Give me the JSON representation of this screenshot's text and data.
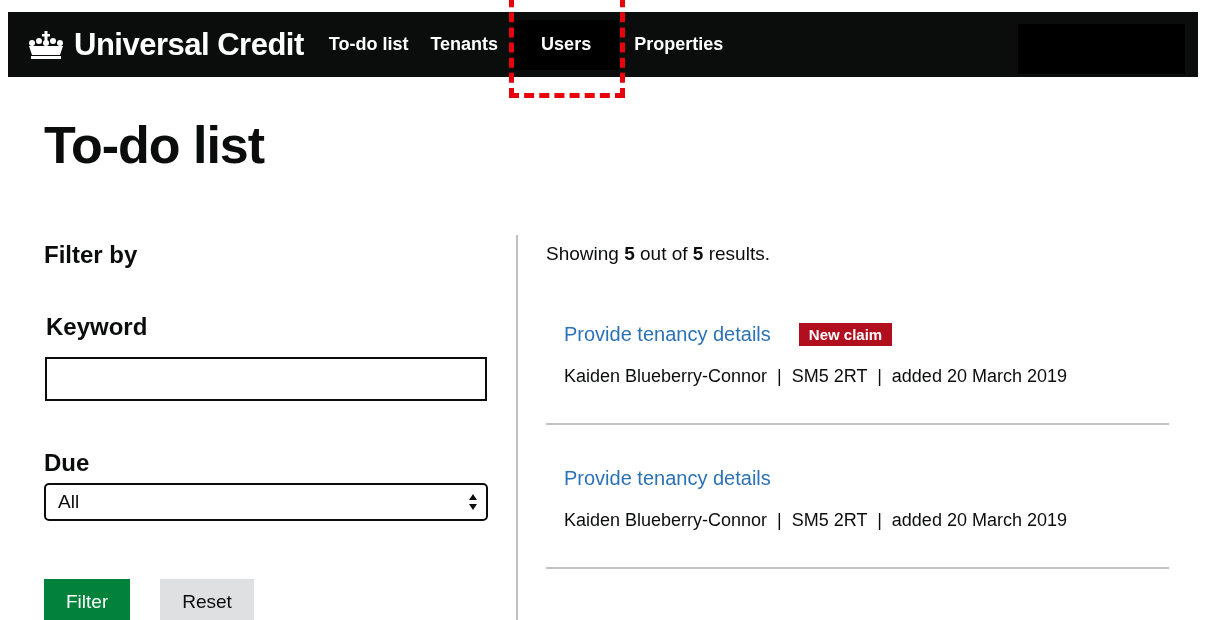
{
  "header": {
    "service_name": "Universal Credit",
    "nav": [
      {
        "label": "To-do list",
        "selected": false,
        "highlighted": false
      },
      {
        "label": "Tenants",
        "selected": false,
        "highlighted": false
      },
      {
        "label": "Users",
        "selected": true,
        "highlighted": true
      },
      {
        "label": "Properties",
        "selected": false,
        "highlighted": false
      }
    ],
    "redacted": true
  },
  "page_title": "To-do list",
  "filter": {
    "heading": "Filter by",
    "keyword": {
      "label": "Keyword"
    },
    "due": {
      "label": "Due",
      "value": "All"
    },
    "buttons": [
      {
        "label": "Filter",
        "kind": "primary"
      },
      {
        "label": "Reset",
        "kind": "secondary"
      }
    ]
  },
  "results": {
    "summary": "Showing **5** out of **5** results.",
    "items": [
      {
        "title": "Provide tenancy details",
        "tag": "New claim",
        "meta": "Kaiden Blueberry-Connor  |  SM5 2RT  |  added 20 March 2019"
      },
      {
        "title": "Provide tenancy details",
        "meta": "Kaiden Blueberry-Connor  |  SM5 2RT  |  added 20 March 2019"
      }
    ]
  }
}
